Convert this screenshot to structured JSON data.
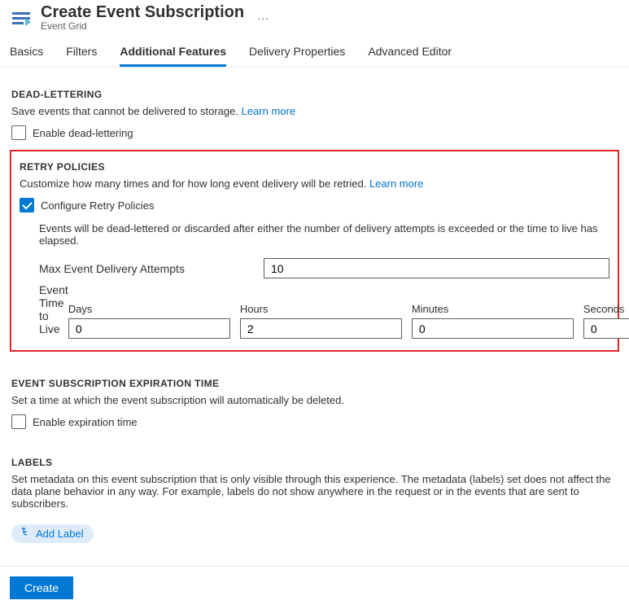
{
  "header": {
    "title": "Create Event Subscription",
    "subtitle": "Event Grid"
  },
  "tabs": [
    "Basics",
    "Filters",
    "Additional Features",
    "Delivery Properties",
    "Advanced Editor"
  ],
  "activeTab": "Additional Features",
  "deadLettering": {
    "title": "DEAD-LETTERING",
    "desc": "Save events that cannot be delivered to storage.",
    "learn": "Learn more",
    "checkboxLabel": "Enable dead-lettering",
    "checked": false
  },
  "retry": {
    "title": "RETRY POLICIES",
    "desc": "Customize how many times and for how long event delivery will be retried.",
    "learn": "Learn more",
    "checkboxLabel": "Configure Retry Policies",
    "checked": true,
    "hint": "Events will be dead-lettered or discarded after either the number of delivery attempts is exceeded or the time to live has elapsed.",
    "maxAttemptsLabel": "Max Event Delivery Attempts",
    "maxAttemptsValue": "10",
    "ttlLabel": "Event Time to Live",
    "ttl": {
      "daysLabel": "Days",
      "daysValue": "0",
      "hoursLabel": "Hours",
      "hoursValue": "2",
      "minutesLabel": "Minutes",
      "minutesValue": "0",
      "secondsLabel": "Seconds",
      "secondsValue": "0"
    }
  },
  "expiration": {
    "title": "EVENT SUBSCRIPTION EXPIRATION TIME",
    "desc": "Set a time at which the event subscription will automatically be deleted.",
    "checkboxLabel": "Enable expiration time",
    "checked": false
  },
  "labels": {
    "title": "LABELS",
    "desc": "Set metadata on this event subscription that is only visible through this experience. The metadata (labels) set does not affect the data plane behavior in any way. For example, labels do not show anywhere in the request or in the events that are sent to subscribers.",
    "addLabel": "Add Label"
  },
  "footer": {
    "create": "Create"
  }
}
